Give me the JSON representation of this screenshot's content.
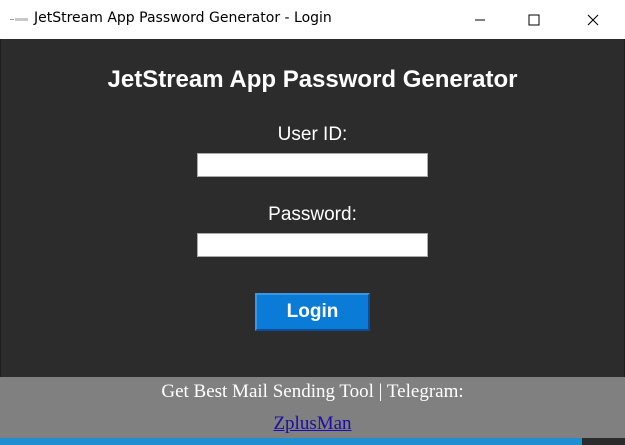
{
  "window": {
    "title": "JetStream App Password Generator - Login",
    "controls": {
      "minimize": "minimize-icon",
      "maximize": "maximize-icon",
      "close": "close-icon"
    }
  },
  "form": {
    "heading": "JetStream App Password Generator",
    "user_id_label": "User ID:",
    "user_id_value": "",
    "password_label": "Password:",
    "password_value": "",
    "login_label": "Login"
  },
  "footer": {
    "promo_text": "Get Best Mail Sending Tool | Telegram:",
    "link_text": "ZplusMan"
  },
  "colors": {
    "content_bg": "#2c2c2c",
    "footer_bg": "#808080",
    "button_bg": "#0a7bd6",
    "link": "#1a0dab"
  }
}
